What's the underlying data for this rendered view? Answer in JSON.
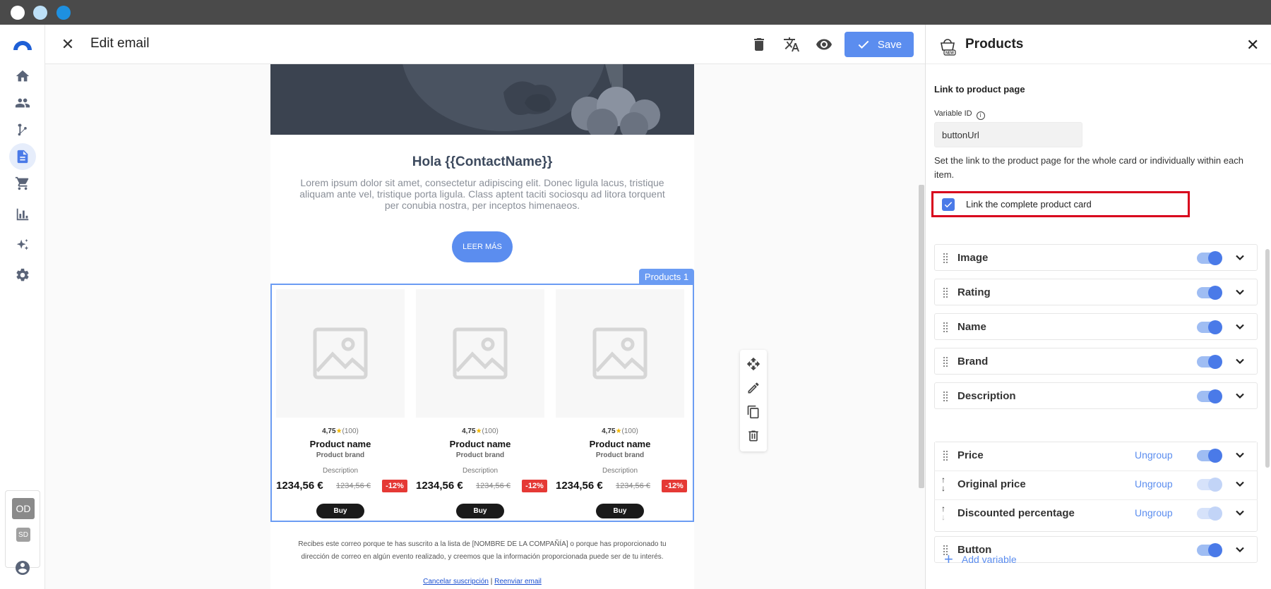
{
  "header": {
    "title": "Edit email",
    "save_label": "Save"
  },
  "email": {
    "greeting": "Hola {{ContactName}}",
    "body": "Lorem ipsum dolor sit amet, consectetur adipiscing elit. Donec ligula lacus, tristique aliquam ante vel, tristique porta ligula. Class aptent taciti sociosqu ad litora torquent per conubia nostra, per inceptos himenaeos.",
    "cta_label": "LEER MÁS",
    "products_tag": "Products 1",
    "cards": [
      {
        "rating": "4,75",
        "reviews": "(100)",
        "name": "Product name",
        "brand": "Product brand",
        "description": "Description",
        "price": "1234,56 €",
        "original_price": "1234,56 €",
        "discount": "-12%",
        "buy": "Buy"
      },
      {
        "rating": "4,75",
        "reviews": "(100)",
        "name": "Product name",
        "brand": "Product brand",
        "description": "Description",
        "price": "1234,56 €",
        "original_price": "1234,56 €",
        "discount": "-12%",
        "buy": "Buy"
      },
      {
        "rating": "4,75",
        "reviews": "(100)",
        "name": "Product name",
        "brand": "Product brand",
        "description": "Description",
        "price": "1234,56 €",
        "original_price": "1234,56 €",
        "discount": "-12%",
        "buy": "Buy"
      }
    ],
    "footer_text": "Recibes este correo porque te has suscrito a la lista de [NOMBRE DE LA COMPAÑÍA] o porque has proporcionado tu dirección de correo en algún evento realizado, y creemos que la información proporcionada puede ser de tu interés.",
    "unsubscribe": "Cancelar suscripción",
    "separator": "|",
    "forward": "Reenviar email"
  },
  "sidebar": {
    "org_primary": "OD",
    "org_secondary": "SD"
  },
  "panel": {
    "title": "Products",
    "section_title": "Link to product page",
    "variable_id_label": "Variable ID",
    "variable_id_value": "buttonUrl",
    "help_text": "Set the link to the product page for the whole card or individually within each item.",
    "link_complete_label": "Link the complete product card",
    "link_complete_checked": true,
    "variables": [
      {
        "label": "Image",
        "enabled": true
      },
      {
        "label": "Rating",
        "enabled": true
      },
      {
        "label": "Name",
        "enabled": true
      },
      {
        "label": "Brand",
        "enabled": true
      },
      {
        "label": "Description",
        "enabled": true
      },
      {
        "label": "Price",
        "enabled": true,
        "ungroup": "Ungroup"
      },
      {
        "label": "Original price",
        "enabled": false,
        "ungroup": "Ungroup"
      },
      {
        "label": "Discounted percentage",
        "enabled": false,
        "ungroup": "Ungroup"
      },
      {
        "label": "Button",
        "enabled": true
      }
    ],
    "add_variable": "Add variable"
  },
  "colors": {
    "accent": "#5b8def",
    "highlight": "#d8001c",
    "discount": "#e53935"
  }
}
